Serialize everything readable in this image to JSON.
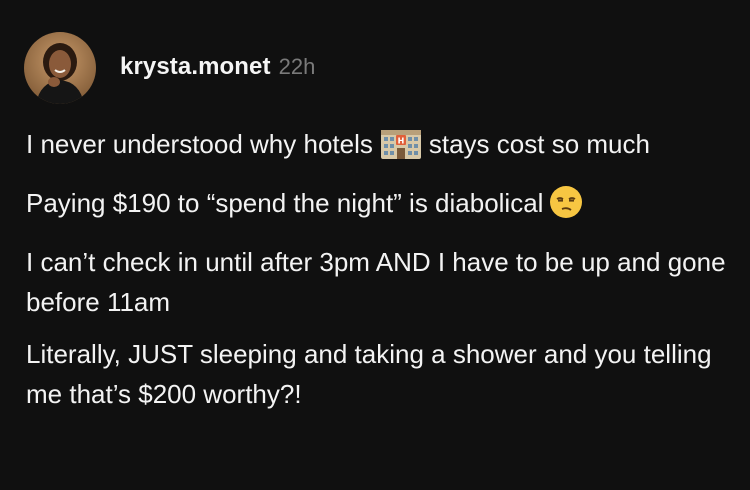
{
  "post": {
    "author": {
      "username": "krysta.monet",
      "time_ago": "22h"
    },
    "paragraphs": [
      {
        "before_emoji": "I never understood why hotels",
        "emoji": "hotel-emoji",
        "after_emoji": "stays cost so much"
      },
      {
        "before_emoji": "Paying $190 to “spend the night” is diabolical",
        "emoji": "unamused-face-emoji",
        "after_emoji": ""
      },
      {
        "text": "I can’t check in until after 3pm AND I have to be up and gone before 11am"
      },
      {
        "text": "Literally, JUST sleeping and taking a shower and you telling me that’s $200 worthy?!"
      }
    ]
  },
  "colors": {
    "background": "#101010",
    "text": "#f3f3f3",
    "muted": "#7a7a7a"
  }
}
